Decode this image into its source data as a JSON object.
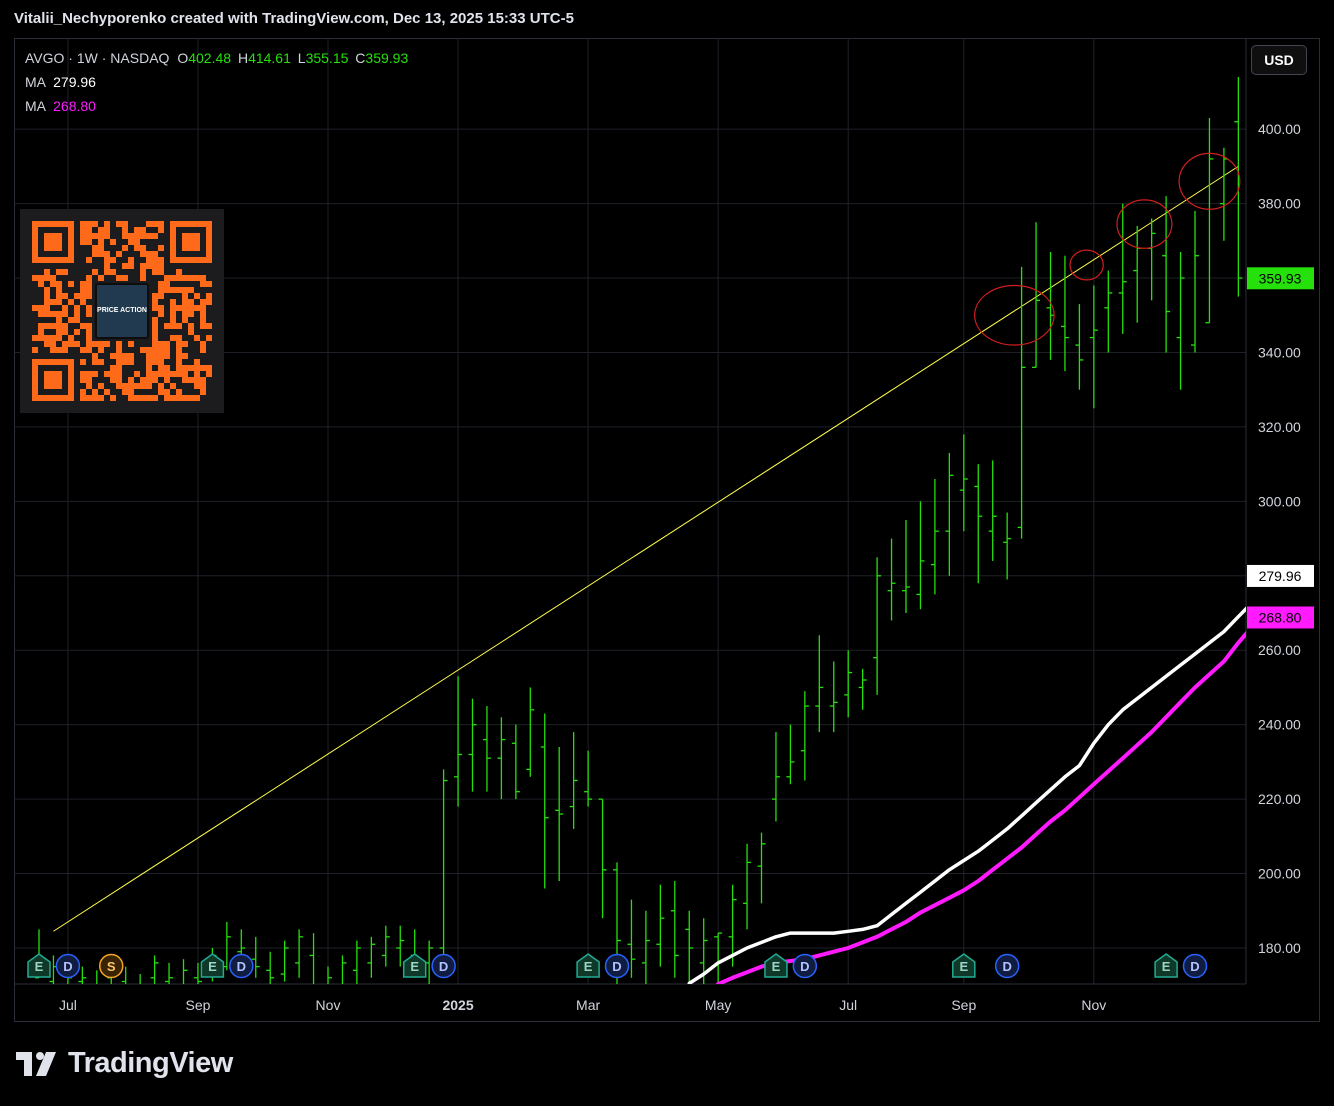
{
  "header": "Vitalii_Nechyporenko created with TradingView.com, Dec 13, 2025 15:33 UTC-5",
  "symbol_line": {
    "symbol": "AVGO · 1W · NASDAQ",
    "o_label": "O",
    "o": "402.48",
    "h_label": "H",
    "h": "414.61",
    "l_label": "L",
    "l": "355.15",
    "c_label": "C",
    "c": "359.93"
  },
  "ma1": {
    "label": "MA",
    "value": "279.96",
    "color": "#ffffff"
  },
  "ma2": {
    "label": "MA",
    "value": "268.80",
    "color": "#ff1aff"
  },
  "currency": "USD",
  "brand": "TradingView",
  "qr_badge": "PRICE ACTION",
  "colors": {
    "bar": "#26e00c",
    "trendline": "#ffff4d",
    "circle": "#d21e1e",
    "grid": "#1e2128",
    "background": "#000000"
  },
  "chart_data": {
    "type": "ohlc-bar",
    "ylim": [
      170,
      416
    ],
    "y_ticks": [
      "180.00",
      "200.00",
      "220.00",
      "240.00",
      "260.00",
      "280.00",
      "300.00",
      "320.00",
      "340.00",
      "360.00",
      "380.00",
      "400.00"
    ],
    "x_ticks": [
      {
        "label": "Jul",
        "week": 2,
        "bold": false
      },
      {
        "label": "Sep",
        "week": 11,
        "bold": false
      },
      {
        "label": "Nov",
        "week": 20,
        "bold": false
      },
      {
        "label": "2025",
        "week": 29,
        "bold": true
      },
      {
        "label": "Mar",
        "week": 38,
        "bold": false
      },
      {
        "label": "May",
        "week": 47,
        "bold": false
      },
      {
        "label": "Jul",
        "week": 56,
        "bold": false
      },
      {
        "label": "Sep",
        "week": 64,
        "bold": false
      },
      {
        "label": "Nov",
        "week": 73,
        "bold": false
      }
    ],
    "bars": [
      [
        172,
        185,
        172,
        176
      ],
      [
        171,
        178,
        170,
        175
      ],
      [
        173,
        177,
        168,
        172
      ],
      [
        171,
        175,
        168,
        172
      ],
      [
        170,
        174,
        166,
        169
      ],
      [
        172,
        176,
        170,
        173
      ],
      [
        171,
        175,
        168,
        170
      ],
      [
        169,
        173,
        165,
        168
      ],
      [
        172,
        178,
        169,
        176
      ],
      [
        171,
        176,
        168,
        172
      ],
      [
        170,
        177,
        168,
        174
      ],
      [
        172,
        176,
        169,
        171
      ],
      [
        173,
        180,
        171,
        178
      ],
      [
        175,
        187,
        174,
        183
      ],
      [
        179,
        185,
        176,
        180
      ],
      [
        177,
        183,
        172,
        175
      ],
      [
        174,
        179,
        170,
        172
      ],
      [
        173,
        182,
        171,
        180
      ],
      [
        176,
        185,
        172,
        183
      ],
      [
        178,
        184,
        168,
        170
      ],
      [
        168,
        175,
        163,
        172
      ],
      [
        169,
        178,
        166,
        176
      ],
      [
        174,
        182,
        170,
        180
      ],
      [
        176,
        183,
        172,
        181
      ],
      [
        178,
        186,
        175,
        183
      ],
      [
        180,
        186,
        175,
        182
      ],
      [
        178,
        185,
        172,
        176
      ],
      [
        176,
        182,
        170,
        180
      ],
      [
        180,
        228,
        178,
        225
      ],
      [
        226,
        253,
        218,
        232
      ],
      [
        232,
        247,
        222,
        240
      ],
      [
        236,
        245,
        222,
        231
      ],
      [
        231,
        242,
        220,
        236
      ],
      [
        235,
        240,
        220,
        222
      ],
      [
        228,
        250,
        226,
        244
      ],
      [
        234,
        243,
        196,
        215
      ],
      [
        217,
        234,
        198,
        216
      ],
      [
        218,
        238,
        212,
        225
      ],
      [
        222,
        233,
        218,
        220
      ],
      [
        220,
        220,
        188,
        201
      ],
      [
        201,
        203,
        167,
        182
      ],
      [
        181,
        193,
        172,
        177
      ],
      [
        176,
        190,
        170,
        182
      ],
      [
        181,
        197,
        175,
        188
      ],
      [
        190,
        198,
        172,
        178
      ],
      [
        185,
        190,
        163,
        180
      ],
      [
        176,
        188,
        168,
        182
      ],
      [
        183,
        184,
        168,
        184
      ],
      [
        183,
        197,
        175,
        193
      ],
      [
        192,
        208,
        185,
        203
      ],
      [
        202,
        211,
        192,
        208
      ],
      [
        220,
        238,
        214,
        226
      ],
      [
        226,
        240,
        224,
        230
      ],
      [
        233,
        249,
        225,
        245
      ],
      [
        245,
        264,
        238,
        250
      ],
      [
        245,
        257,
        238,
        246
      ],
      [
        248,
        260,
        242,
        254
      ],
      [
        250,
        255,
        244,
        252
      ],
      [
        258,
        285,
        248,
        280
      ],
      [
        276,
        290,
        268,
        278
      ],
      [
        276,
        295,
        270,
        277
      ],
      [
        275,
        300,
        271,
        284
      ],
      [
        283,
        306,
        275,
        292
      ],
      [
        292,
        313,
        280,
        307
      ],
      [
        303,
        318,
        292,
        306
      ],
      [
        304,
        310,
        278,
        296
      ],
      [
        292,
        311,
        284,
        296
      ],
      [
        289,
        297,
        279,
        290
      ],
      [
        293,
        363,
        290,
        336
      ],
      [
        336,
        375,
        336,
        354
      ],
      [
        352,
        367,
        338,
        350
      ],
      [
        347,
        366,
        335,
        344
      ],
      [
        342,
        353,
        330,
        338
      ],
      [
        344,
        358,
        325,
        346
      ],
      [
        352,
        362,
        340,
        356
      ],
      [
        356,
        380,
        345,
        359
      ],
      [
        362,
        374,
        348,
        368
      ],
      [
        368,
        376,
        354,
        372
      ],
      [
        366,
        382,
        340,
        351
      ],
      [
        344,
        367,
        330,
        360
      ],
      [
        342,
        378,
        340,
        366
      ],
      [
        348,
        403,
        348,
        392
      ],
      [
        380,
        395,
        370,
        392
      ],
      [
        402,
        414,
        355,
        360
      ]
    ],
    "ma_fast_start": 45,
    "ma_fast": [
      170.5,
      173,
      176,
      178,
      180,
      181.5,
      183,
      184,
      184,
      184,
      184,
      184.5,
      185,
      186,
      189,
      192,
      195,
      198,
      201,
      203.5,
      206,
      209,
      212,
      215.5,
      219,
      222.5,
      226,
      229,
      235,
      240,
      244,
      247,
      250,
      253,
      256,
      259,
      262,
      265,
      269,
      273,
      276,
      280
    ],
    "ma_slow_start": 47,
    "ma_slow": [
      170.3,
      172,
      173.5,
      175,
      176,
      176.5,
      177,
      178,
      179,
      180,
      181.5,
      183,
      185,
      187,
      189.5,
      191.5,
      193.5,
      195.5,
      198,
      201,
      204,
      207,
      210.5,
      214,
      217,
      220.5,
      224,
      227.5,
      231,
      234.5,
      238,
      242,
      246,
      250,
      253.5,
      257,
      262,
      266.5,
      268.8
    ],
    "trendline": [
      [
        1,
        184.5
      ],
      [
        83,
        390
      ]
    ],
    "ellipses": [
      [
        67.5,
        350,
        2.75,
        8
      ],
      [
        72.5,
        363.5,
        1.15,
        4
      ],
      [
        76.5,
        374.5,
        1.9,
        6.5
      ],
      [
        81,
        386,
        2.1,
        7.5
      ]
    ],
    "events": [
      {
        "label": "E",
        "week": 0,
        "type": "e"
      },
      {
        "label": "D",
        "week": 2,
        "type": "d"
      },
      {
        "label": "S",
        "week": 5,
        "type": "s"
      },
      {
        "label": "E",
        "week": 12,
        "type": "e"
      },
      {
        "label": "D",
        "week": 14,
        "type": "d"
      },
      {
        "label": "E",
        "week": 26,
        "type": "e"
      },
      {
        "label": "D",
        "week": 28,
        "type": "d"
      },
      {
        "label": "E",
        "week": 38,
        "type": "e"
      },
      {
        "label": "D",
        "week": 40,
        "type": "d"
      },
      {
        "label": "E",
        "week": 51,
        "type": "e"
      },
      {
        "label": "D",
        "week": 53,
        "type": "d"
      },
      {
        "label": "E",
        "week": 64,
        "type": "e"
      },
      {
        "label": "D",
        "week": 67,
        "type": "d"
      },
      {
        "label": "E",
        "week": 78,
        "type": "e"
      },
      {
        "label": "D",
        "week": 80,
        "type": "d"
      }
    ],
    "price_labels": [
      {
        "value": "359.93",
        "y": 359.93,
        "bg": "#26e00c",
        "fg": "#000000"
      },
      {
        "value": "279.96",
        "y": 279.96,
        "bg": "#ffffff",
        "fg": "#000000"
      },
      {
        "value": "268.80",
        "y": 268.8,
        "bg": "#ff1aff",
        "fg": "#000000"
      }
    ]
  }
}
